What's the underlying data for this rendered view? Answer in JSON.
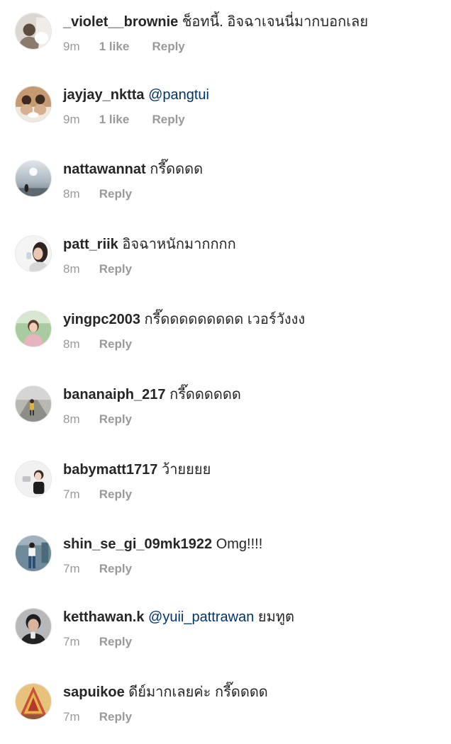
{
  "comments": [
    {
      "username": "_violet__brownie",
      "text": "ช็อทนี้. อิจฉาเจนนี่มากบอกเลย",
      "mention": "",
      "time": "9m",
      "likes": "1 like",
      "reply": "Reply",
      "avatar_colors": [
        "#d9d4cf",
        "#7a6a5d"
      ]
    },
    {
      "username": "jayjay_nktta",
      "text": "",
      "mention": "@pangtui",
      "time": "9m",
      "likes": "1 like",
      "reply": "Reply",
      "avatar_colors": [
        "#b58a63",
        "#3d2b22"
      ]
    },
    {
      "username": "nattawannat",
      "text": "กรี๊ดดดด",
      "mention": "",
      "time": "8m",
      "likes": "",
      "reply": "Reply",
      "avatar_colors": [
        "#c9d3dc",
        "#4c5862"
      ]
    },
    {
      "username": "patt_riik",
      "text": "อิจฉาหนักมากกกก",
      "mention": "",
      "time": "8m",
      "likes": "",
      "reply": "Reply",
      "avatar_colors": [
        "#f3f3f3",
        "#2c2320"
      ]
    },
    {
      "username": "yingpc2003",
      "text": "กรี๊ดดดดดดดดด เวอร์วังงง",
      "mention": "",
      "time": "8m",
      "likes": "",
      "reply": "Reply",
      "avatar_colors": [
        "#a5c79a",
        "#e6b4be"
      ]
    },
    {
      "username": "bananaiph_217",
      "text": "กรี๊ดดดดดด",
      "mention": "",
      "time": "8m",
      "likes": "",
      "reply": "Reply",
      "avatar_colors": [
        "#9a9a96",
        "#e6b23c"
      ]
    },
    {
      "username": "babymatt1717",
      "text": "ว้ายยยย",
      "mention": "",
      "time": "7m",
      "likes": "",
      "reply": "Reply",
      "avatar_colors": [
        "#eeeeee",
        "#1d1d1d"
      ]
    },
    {
      "username": "shin_se_gi_09mk1922",
      "text": "Omg!!!!",
      "mention": "",
      "time": "7m",
      "likes": "",
      "reply": "Reply",
      "avatar_colors": [
        "#6f8a98",
        "#2e4c78"
      ]
    },
    {
      "username": "ketthawan.k",
      "text": "ยมทูต",
      "mention": "@yuii_pattrawan",
      "time": "7m",
      "likes": "",
      "reply": "Reply",
      "avatar_colors": [
        "#b6b8ba",
        "#232323"
      ]
    },
    {
      "username": "sapuikoe",
      "text": "ดีย์มากเลยค่ะ กรี๊ดดดด",
      "mention": "",
      "time": "7m",
      "likes": "",
      "reply": "Reply",
      "avatar_colors": [
        "#c6503a",
        "#e8b24a"
      ]
    }
  ]
}
